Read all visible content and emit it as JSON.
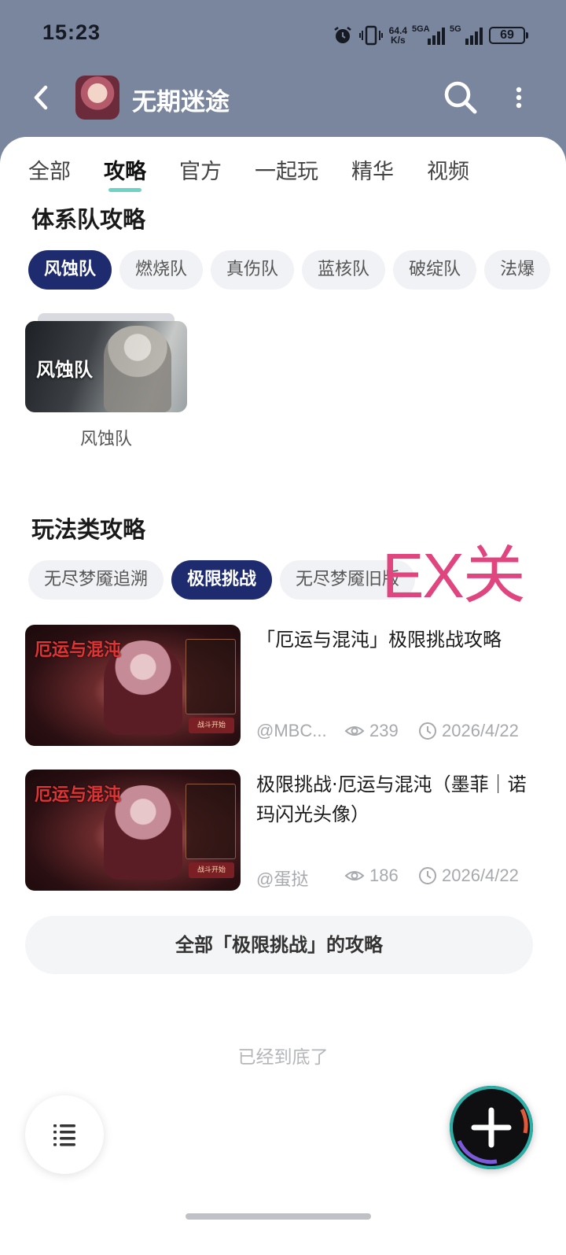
{
  "status_bar": {
    "time": "15:23",
    "net_speed_value": "64.4",
    "net_speed_unit": "K/s",
    "signal1_label": "5GA",
    "signal2_label": "5G",
    "battery": "69"
  },
  "header": {
    "title": "无期迷途",
    "back_icon": "chevron-left-icon",
    "search_icon": "search-icon",
    "more_icon": "more-vertical-icon"
  },
  "tabs": [
    "全部",
    "攻略",
    "官方",
    "一起玩",
    "精华",
    "视频"
  ],
  "active_tab": "攻略",
  "system_section": {
    "title": "体系队攻略",
    "chips": [
      "风蚀队",
      "燃烧队",
      "真伤队",
      "蓝核队",
      "破绽队",
      "法爆"
    ],
    "active_chip": "风蚀队",
    "card": {
      "caption": "风蚀队",
      "label": "风蚀队"
    }
  },
  "play_section": {
    "title": "玩法类攻略",
    "chips": [
      "无尽梦魇追溯",
      "极限挑战",
      "无尽梦魇旧版"
    ],
    "active_chip": "极限挑战",
    "annotation": "EX关",
    "posts": [
      {
        "title": "「厄运与混沌」极限挑战攻略",
        "thumb_title": "厄运与混沌",
        "thumb_button": "战斗开始",
        "author": "@MBC...",
        "views": "239",
        "date": "2026/4/22"
      },
      {
        "title": "极限挑战·厄运与混沌（墨菲｜诺玛闪光头像）",
        "thumb_title": "厄运与混沌",
        "thumb_button": "战斗开始",
        "author": "@蛋挞",
        "views": "186",
        "date": "2026/4/22"
      }
    ],
    "more_link": "全部「极限挑战」的攻略"
  },
  "end_text": "已经到底了",
  "colors": {
    "header_bg": "#7a869e",
    "chip_active": "#1e2b6e",
    "tab_underline": "#6ed3c6",
    "annotation": "#e0457f"
  }
}
